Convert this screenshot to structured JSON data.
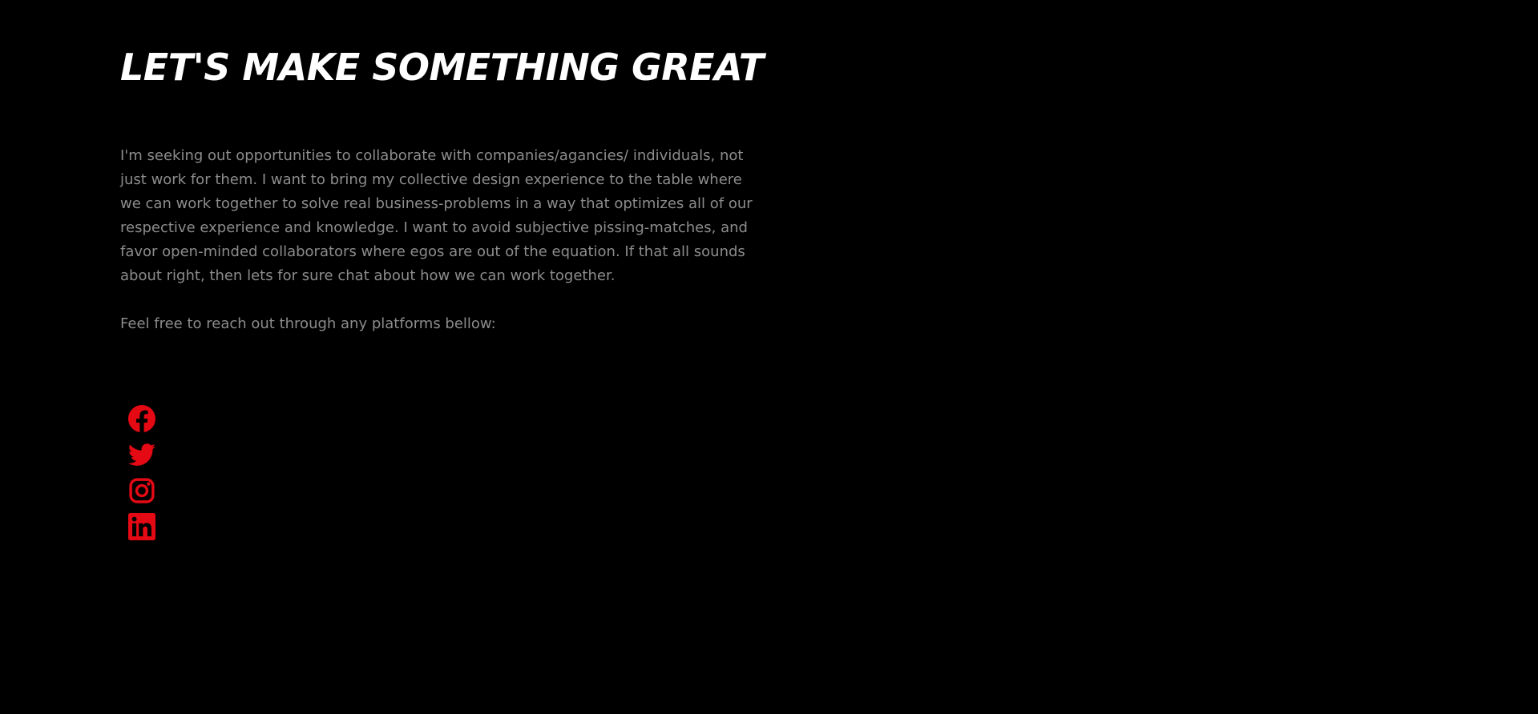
{
  "contact": {
    "title": "LET'S MAKE SOMETHING GREAT",
    "intro": "I'm seeking out opportunities to collaborate with companies/agancies/ individuals, not just work for them. I want to bring my collective design experience to the table where we can work together to solve real business-problems in a way that optimizes all of our respective experience and knowledge. I want to avoid subjective pissing-matches, and favor open-minded collaborators where egos are out of the equation. If that all sounds about right, then lets for sure chat about how we can work together.",
    "cta": "Feel free to reach out through any platforms bellow:"
  },
  "social": {
    "accent_color": "#e50914",
    "links": [
      {
        "name": "facebook",
        "icon": "facebook-icon"
      },
      {
        "name": "twitter",
        "icon": "twitter-icon"
      },
      {
        "name": "instagram",
        "icon": "instagram-icon"
      },
      {
        "name": "linkedin",
        "icon": "linkedin-icon"
      }
    ]
  }
}
